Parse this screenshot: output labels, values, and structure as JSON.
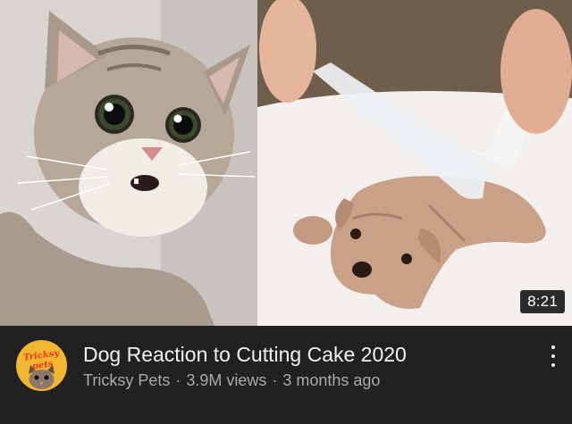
{
  "video": {
    "duration": "8:21",
    "title": "Dog Reaction to Cutting Cake 2020",
    "channel": "Tricksy Pets",
    "views": "3.9M views",
    "age": "3 months ago",
    "separator": "·"
  },
  "channel_avatar": {
    "logo_text": "Tricksy pets",
    "background": "#f2b632",
    "icon": "cat-face-icon"
  },
  "thumbnail": {
    "left_subject": "surprised cat",
    "right_subject": "dog-shaped cake being cut with knife and fork"
  },
  "icons": {
    "more": "vertical-ellipsis-icon"
  },
  "colors": {
    "background": "#212121",
    "title_text": "#f1f1f1",
    "secondary_text": "#aaaaaa"
  }
}
